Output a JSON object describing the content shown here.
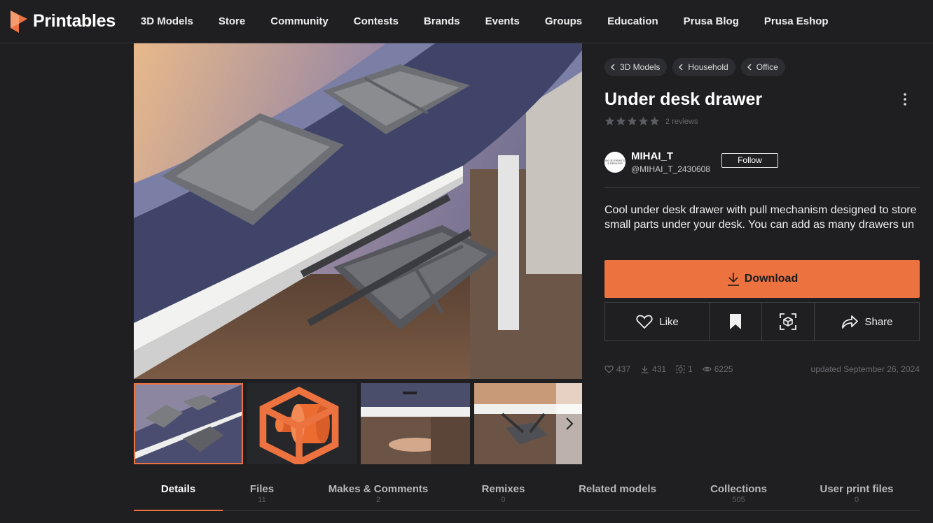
{
  "brand": {
    "name": "Printables",
    "accent": "#ec7340"
  },
  "nav": [
    "3D Models",
    "Store",
    "Community",
    "Contests",
    "Brands",
    "Events",
    "Groups",
    "Education",
    "Prusa Blog",
    "Prusa Eshop"
  ],
  "breadcrumbs": [
    "3D Models",
    "Household",
    "Office"
  ],
  "model": {
    "title": "Under desk drawer",
    "rating": 5,
    "reviews": "2 reviews",
    "author": {
      "name": "MIHAI_T",
      "handle": "@MIHAI_T_2430608",
      "avatar_text": "M3 3D PRINTS & DESIGNS"
    },
    "follow_label": "Follow",
    "description": "Cool under desk drawer with pull mechanism designed to store small parts under your desk. You can add as many drawers un"
  },
  "actions": {
    "download": "Download",
    "like": "Like",
    "share": "Share"
  },
  "stats": {
    "likes": "437",
    "downloads": "431",
    "makes": "1",
    "views": "6225",
    "updated": "updated September 26, 2024"
  },
  "tabs": [
    {
      "label": "Details",
      "count": ""
    },
    {
      "label": "Files",
      "count": "11"
    },
    {
      "label": "Makes & Comments",
      "count": "2"
    },
    {
      "label": "Remixes",
      "count": "0"
    },
    {
      "label": "Related models",
      "count": ""
    },
    {
      "label": "Collections",
      "count": "505"
    },
    {
      "label": "User print files",
      "count": "0"
    }
  ],
  "icons": [
    "printables-logo-icon",
    "chevron-left-icon",
    "kebab-menu-icon",
    "star-icon",
    "download-icon",
    "heart-icon",
    "bookmark-icon",
    "ar-view-icon",
    "share-icon",
    "eye-icon",
    "cube-icon",
    "chevron-right-icon"
  ]
}
